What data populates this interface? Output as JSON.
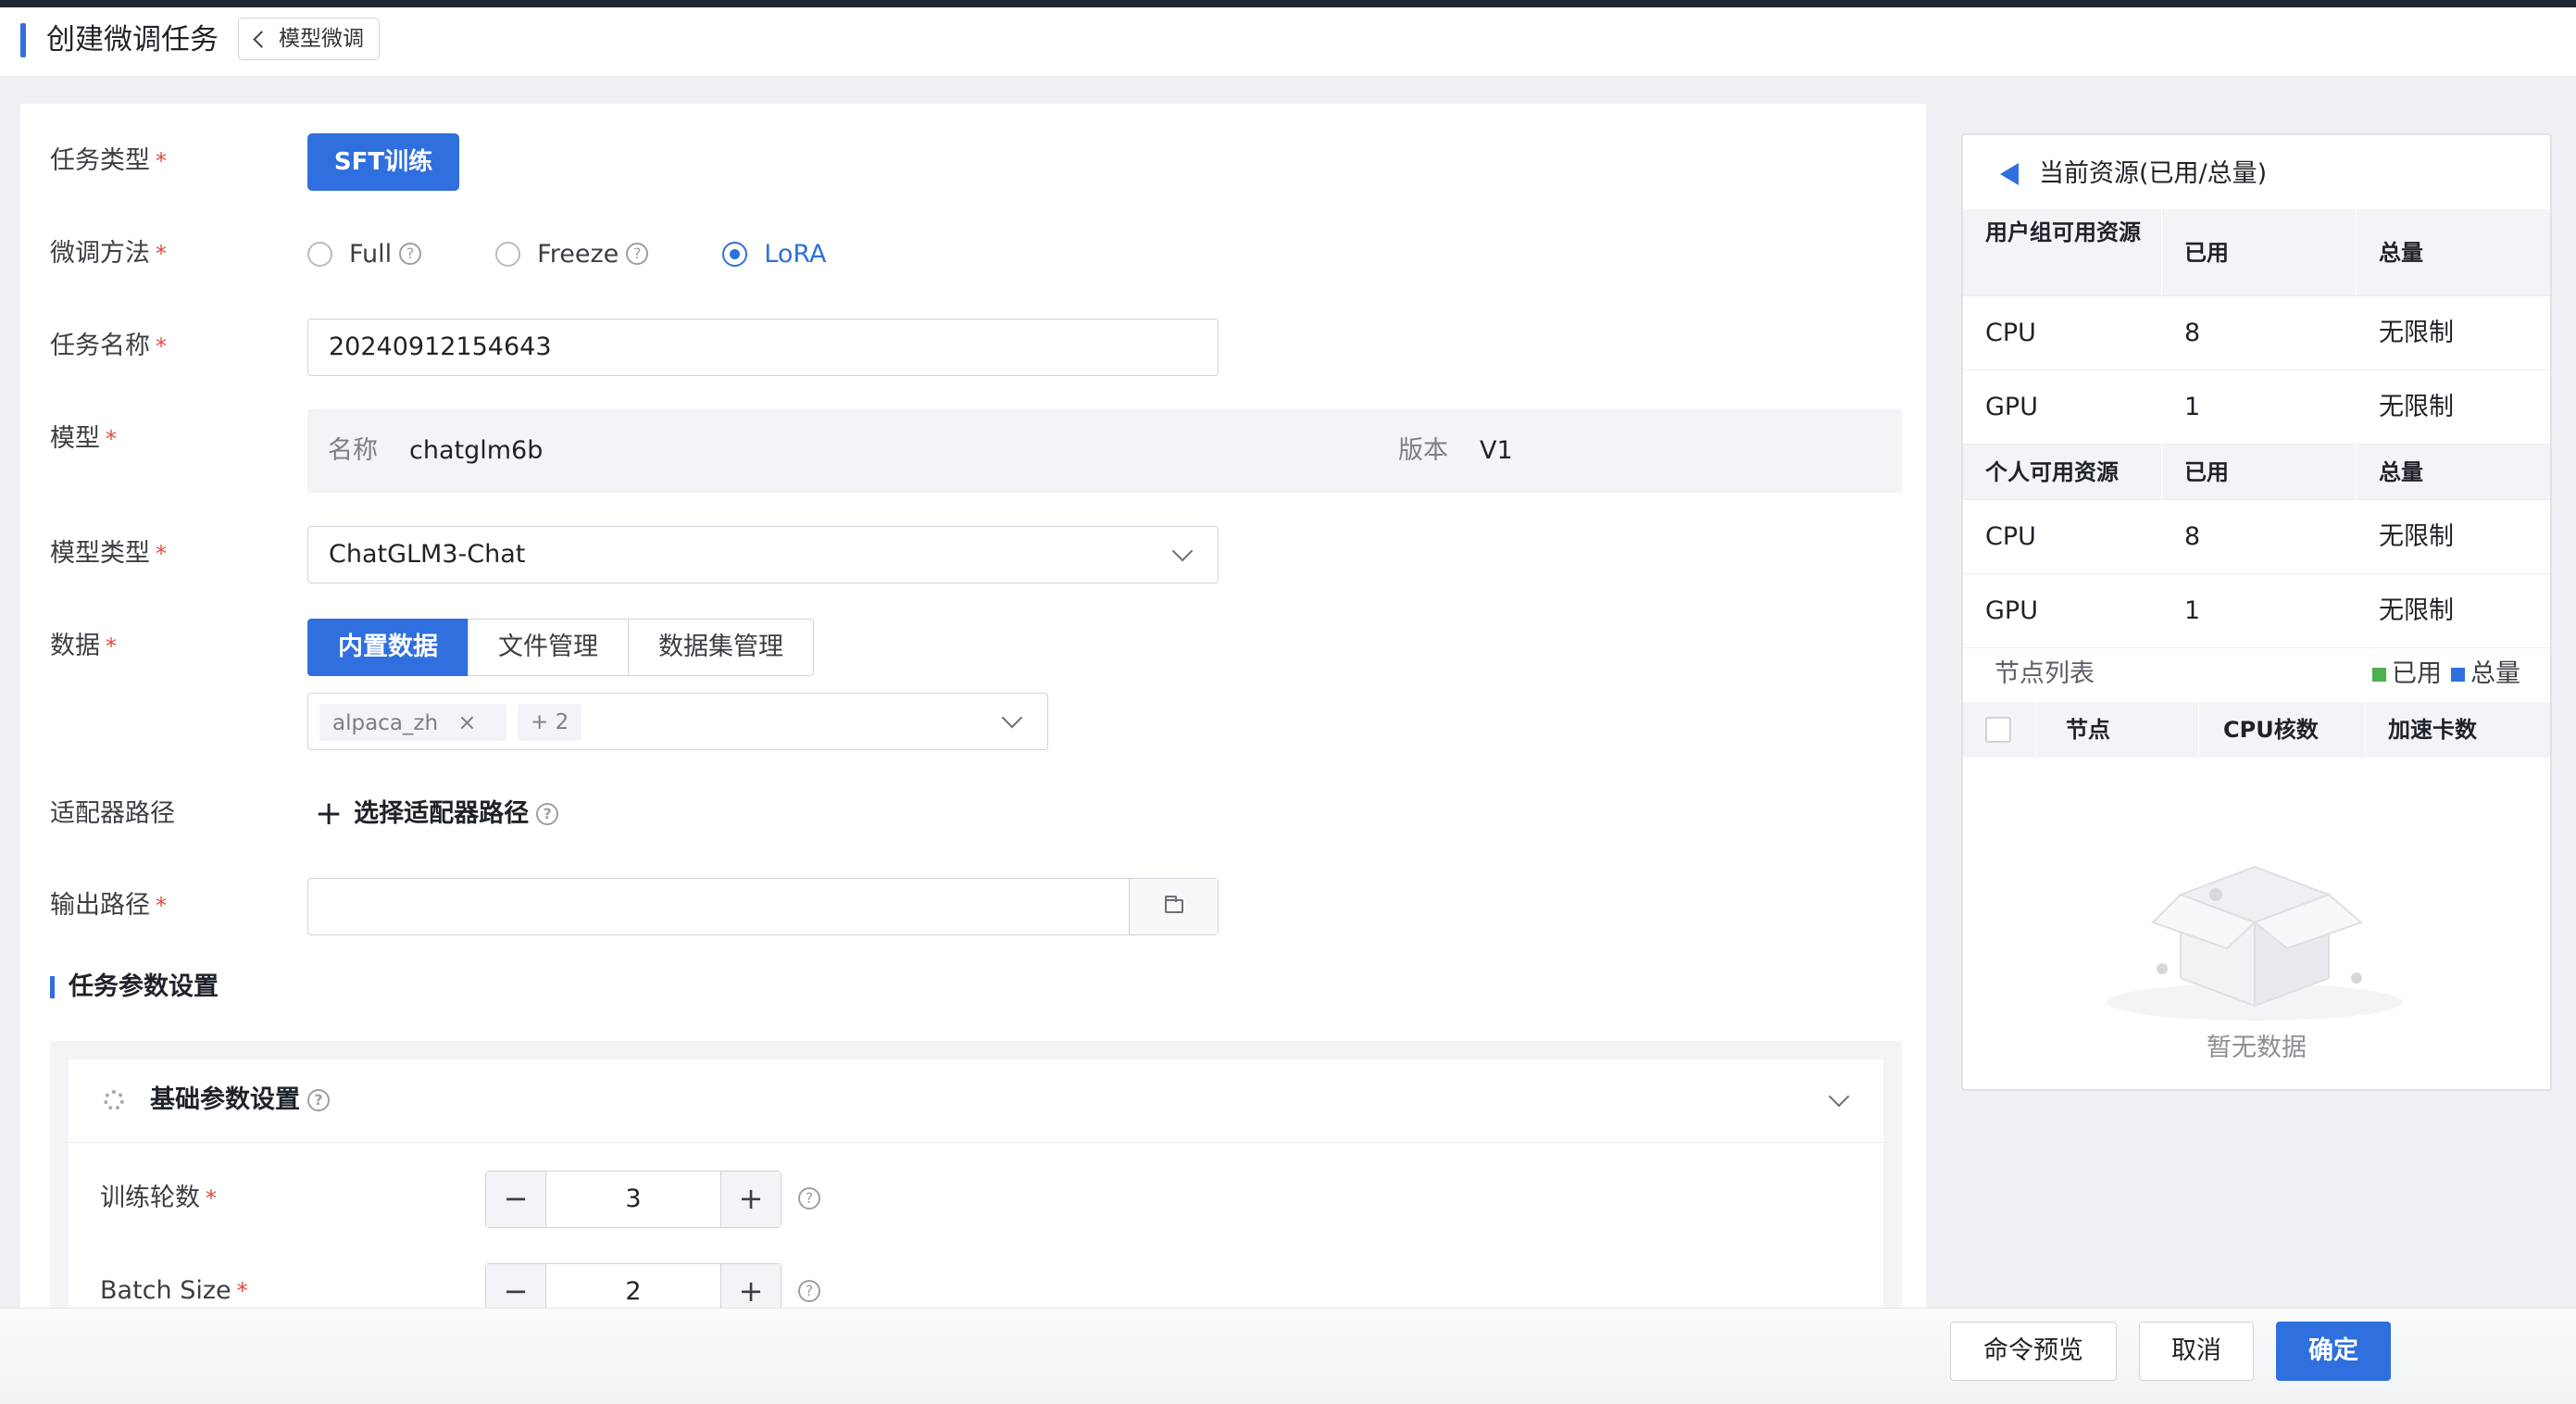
{
  "header": {
    "title": "创建微调任务",
    "back_label": "模型微调"
  },
  "form": {
    "task_type": {
      "label": "任务类型",
      "value": "SFT训练"
    },
    "method": {
      "label": "微调方法",
      "options": [
        {
          "label": "Full",
          "checked": false
        },
        {
          "label": "Freeze",
          "checked": false
        },
        {
          "label": "LoRA",
          "checked": true
        }
      ]
    },
    "task_name": {
      "label": "任务名称",
      "value": "20240912154643"
    },
    "model": {
      "label": "模型",
      "name_key": "名称",
      "name_value": "chatglm6b",
      "version_key": "版本",
      "version_value": "V1"
    },
    "model_type": {
      "label": "模型类型",
      "value": "ChatGLM3-Chat"
    },
    "data": {
      "label": "数据",
      "tabs": [
        "内置数据",
        "文件管理",
        "数据集管理"
      ],
      "active_tab": "内置数据",
      "tag": "alpaca_zh",
      "more": "+ 2"
    },
    "adapter": {
      "label": "适配器路径",
      "action": "选择适配器路径"
    },
    "output": {
      "label": "输出路径",
      "value": ""
    }
  },
  "params": {
    "section_title": "任务参数设置",
    "basic_title": "基础参数设置",
    "epochs": {
      "label": "训练轮数",
      "value": "3"
    },
    "batch_size": {
      "label": "Batch Size",
      "value": "2"
    }
  },
  "resources": {
    "title": "当前资源(已用/总量)",
    "group": {
      "headers": [
        "用户组可用资源",
        "已用",
        "总量"
      ],
      "rows": [
        {
          "name": "CPU",
          "used": "8",
          "total": "无限制"
        },
        {
          "name": "GPU",
          "used": "1",
          "total": "无限制"
        }
      ]
    },
    "personal": {
      "headers": [
        "个人可用资源",
        "已用",
        "总量"
      ],
      "rows": [
        {
          "name": "CPU",
          "used": "8",
          "total": "无限制"
        },
        {
          "name": "GPU",
          "used": "1",
          "total": "无限制"
        }
      ]
    },
    "nodes": {
      "label": "节点列表",
      "legend_used": "已用",
      "legend_total": "总量",
      "legend_used_color": "#4caf50",
      "legend_total_color": "#2f6fde",
      "headers": [
        "节点",
        "CPU核数",
        "加速卡数"
      ],
      "empty": "暂无数据"
    }
  },
  "footer": {
    "preview": "命令预览",
    "cancel": "取消",
    "confirm": "确定"
  }
}
